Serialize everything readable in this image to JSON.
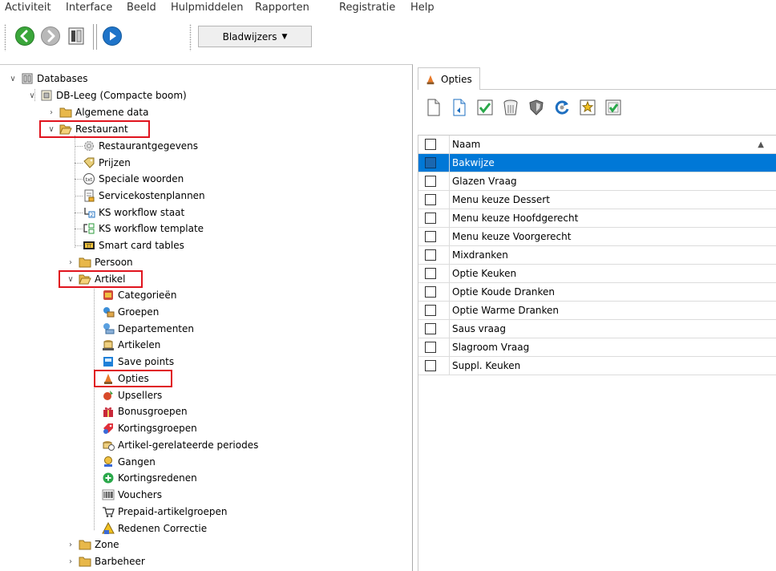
{
  "menu": [
    "Activiteit",
    "Interface",
    "Beeld",
    "Hulpmiddelen",
    "Rapporten",
    "Registratie",
    "Help"
  ],
  "toolbar": {
    "back_icon": "back-arrow-icon",
    "forward_icon": "forward-arrow-icon",
    "panel_icon": "panel-icon",
    "play_icon": "play-icon",
    "bookmarks_label": "Bladwijzers"
  },
  "tree": {
    "databases": "Databases",
    "db": "DB-Leeg (Compacte boom)",
    "algemene": "Algemene data",
    "restaurant": "Restaurant",
    "restaurant_children": [
      "Restaurantgegevens",
      "Prijzen",
      "Speciale woorden",
      "Servicekostenplannen",
      "KS workflow staat",
      "KS workflow template",
      "Smart card tables"
    ],
    "persoon": "Persoon",
    "artikel": "Artikel",
    "artikel_children": [
      "Categorieën",
      "Groepen",
      "Departementen",
      "Artikelen",
      "Save points",
      "Opties",
      "Upsellers",
      "Bonusgroepen",
      "Kortingsgroepen",
      "Artikel-gerelateerde periodes",
      "Gangen",
      "Kortingsredenen",
      "Vouchers",
      "Prepaid-artikelgroepen",
      "Redenen Correctie"
    ],
    "zone": "Zone",
    "barbeheer": "Barbeheer"
  },
  "right": {
    "tab_label": "Opties",
    "column_header": "Naam",
    "selected_index": 0,
    "rows": [
      "Bakwijze",
      "Glazen Vraag",
      "Menu keuze Dessert",
      "Menu keuze Hoofdgerecht",
      "Menu keuze Voorgerecht",
      "Mixdranken",
      "Optie Keuken",
      "Optie Koude Dranken",
      "Optie Warme Dranken",
      "Saus vraag",
      "Slagroom Vraag",
      "Suppl. Keuken"
    ]
  },
  "colors": {
    "highlight_box": "#e0141e",
    "selection": "#0078d7",
    "folder": "#e8b84a"
  }
}
